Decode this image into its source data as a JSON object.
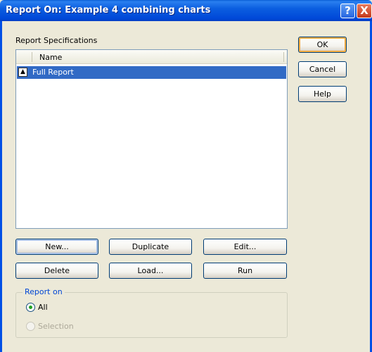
{
  "window": {
    "title": "Report On: Example 4 combining charts",
    "help_glyph": "?",
    "close_glyph": "X"
  },
  "specs": {
    "label": "Report Specifications",
    "column_header": "Name",
    "rows": [
      {
        "label": "Full Report",
        "selected": true,
        "icon": "sort-updown-icon"
      }
    ]
  },
  "dialog_buttons": {
    "ok": "OK",
    "cancel": "Cancel",
    "help": "Help"
  },
  "list_buttons": {
    "new": "New...",
    "duplicate": "Duplicate",
    "edit": "Edit...",
    "delete": "Delete",
    "load": "Load...",
    "run": "Run"
  },
  "report_on": {
    "legend": "Report on",
    "options": [
      {
        "label": "All",
        "checked": true,
        "enabled": true
      },
      {
        "label": "Selection",
        "checked": false,
        "enabled": false
      }
    ]
  },
  "colors": {
    "titlebar": "#0054e3",
    "selection": "#316ac5",
    "dialog_bg": "#ece9d8",
    "group_legend": "#0046d5"
  }
}
